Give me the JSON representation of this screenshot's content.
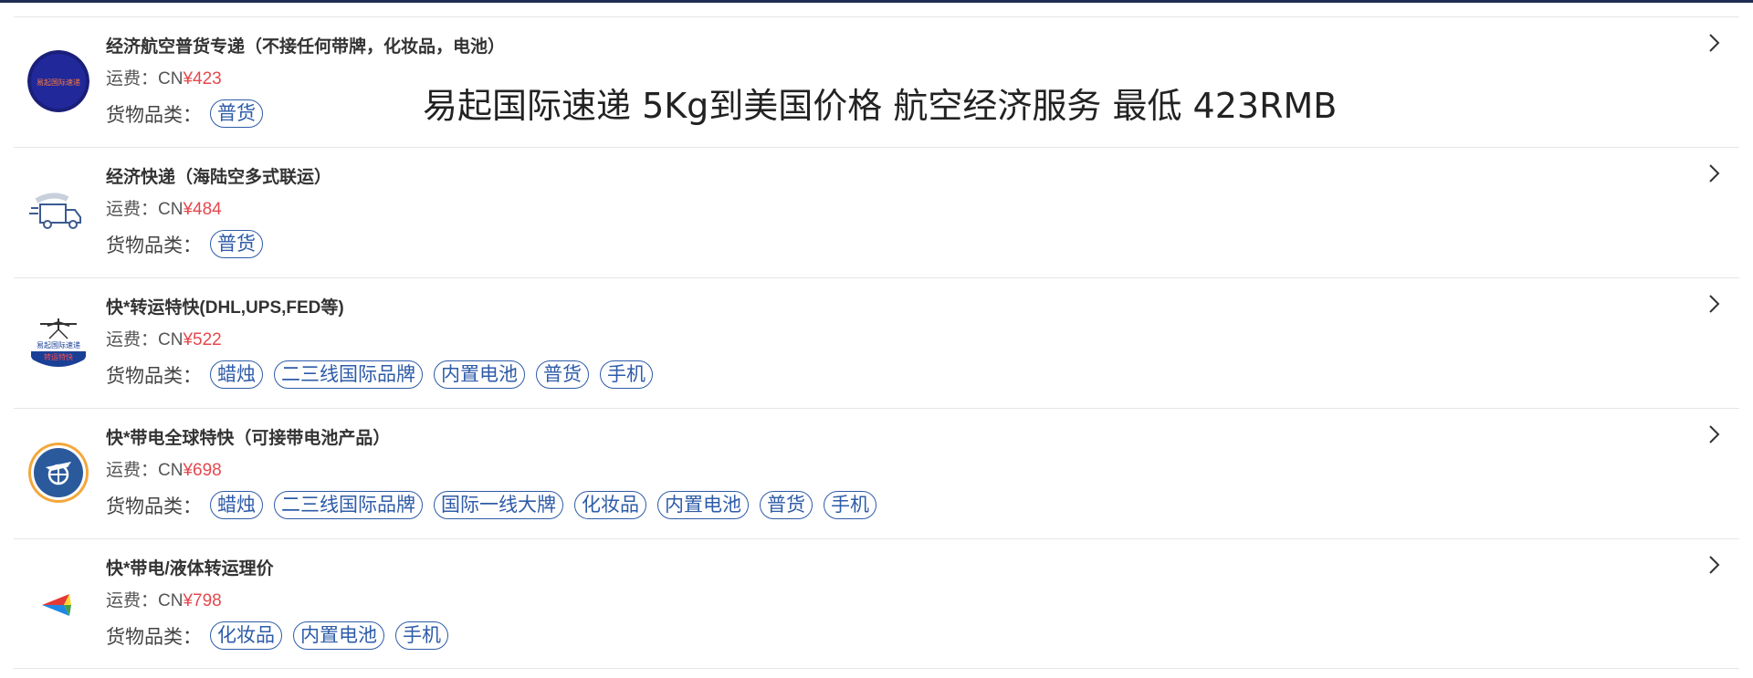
{
  "overlay_caption": "易起国际速递  5Kg到美国价格 航空经济服务 最低  423RMB",
  "fee_prefix": "运费：CN",
  "category_label": "货物品类：",
  "colors": {
    "accent": "#e5484d",
    "tag": "#2e5ba8",
    "top_bar": "#1f2d55"
  },
  "services": [
    {
      "title": "经济航空普货专递（不接任何带牌，化妆品，电池）",
      "price": "¥423",
      "logo_icon": "yiqi-express-logo-icon",
      "logo_text": "易起国际速递",
      "tags": [
        "普货"
      ]
    },
    {
      "title": "经济快递（海陆空多式联运）",
      "price": "¥484",
      "logo_icon": "delivery-truck-icon",
      "tags": [
        "普货"
      ]
    },
    {
      "title": "快*转运特快(DHL,UPS,FED等)",
      "price": "¥522",
      "logo_icon": "airplane-transfer-logo-icon",
      "logo_text": "易起国际速递",
      "logo_subtext": "转运特快",
      "tags": [
        "蜡烛",
        "二三线国际品牌",
        "内置电池",
        "普货",
        "手机"
      ]
    },
    {
      "title": "快*带电全球特快（可接带电池产品）",
      "price": "¥698",
      "logo_icon": "globe-plane-icon",
      "tags": [
        "蜡烛",
        "二三线国际品牌",
        "国际一线大牌",
        "化妆品",
        "内置电池",
        "普货",
        "手机"
      ]
    },
    {
      "title": "快*带电/液体转运理价",
      "price": "¥798",
      "logo_icon": "colorful-arrow-logo-icon",
      "tags": [
        "化妆品",
        "内置电池",
        "手机"
      ]
    }
  ]
}
